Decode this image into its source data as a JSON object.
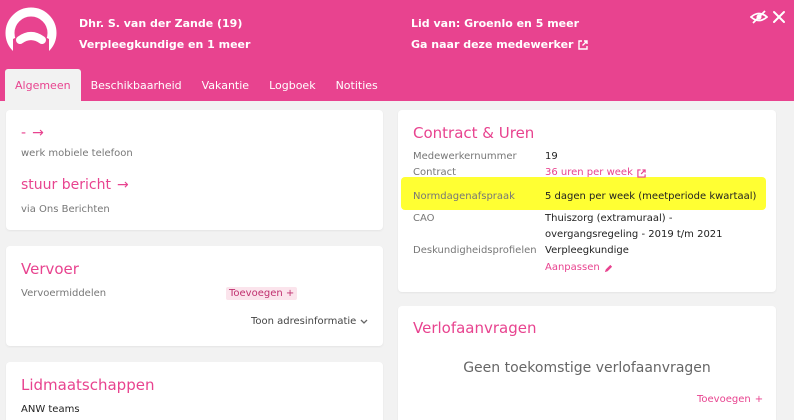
{
  "header": {
    "name": "Dhr. S. van der Zande (19)",
    "role": "Verpleegkundige en 1 meer",
    "member_of": "Lid van: Groenlo en 5 meer",
    "goto_link": "Ga naar deze medewerker",
    "accent": "#e8438f"
  },
  "tabs": [
    "Algemeen",
    "Beschikbaarheid",
    "Vakantie",
    "Logboek",
    "Notities"
  ],
  "contact": {
    "phone_value": "-",
    "phone_label": "werk mobiele telefoon",
    "message_value": "stuur bericht",
    "message_label": "via Ons Berichten"
  },
  "vervoer": {
    "title": "Vervoer",
    "label": "Vervoermiddelen",
    "add": "Toevoegen",
    "address_toggle": "Toon adresinformatie"
  },
  "lidmaatschappen": {
    "title": "Lidmaatschappen",
    "first_item": "ANW teams"
  },
  "contract": {
    "title": "Contract & Uren",
    "rows": [
      {
        "label": "Medewerkernummer",
        "value": "19"
      },
      {
        "label": "Contract",
        "value": "36 uren per week"
      },
      {
        "label": "Normdagenafspraak",
        "value": "5 dagen per week (meetperiode kwartaal)"
      },
      {
        "label": "CAO",
        "value": "Thuiszorg (extramuraal) -",
        "value2": "overgangsregeling - 2019 t/m 2021"
      },
      {
        "label": "Deskundigheidsprofielen",
        "value": "Verpleegkundige"
      }
    ],
    "edit_link": "Aanpassen"
  },
  "verlof": {
    "title": "Verlofaanvragen",
    "empty": "Geen toekomstige verlofaanvragen",
    "add": "Toevoegen"
  }
}
